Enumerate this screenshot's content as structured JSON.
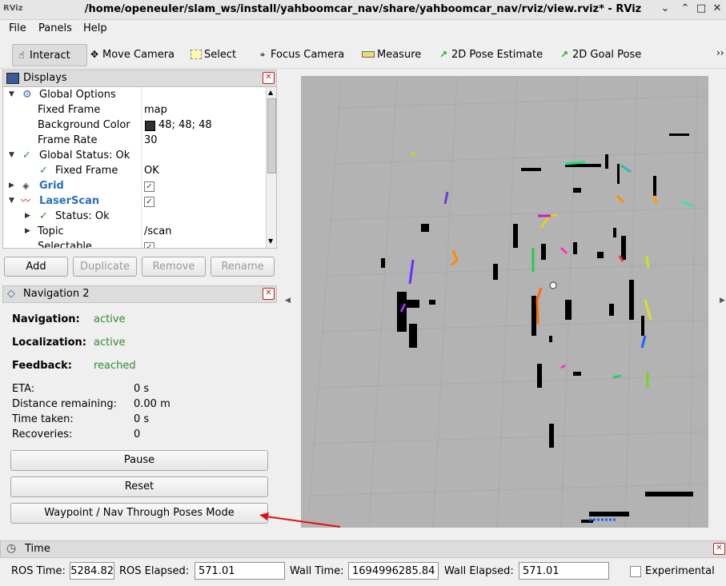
{
  "window": {
    "title": "/home/openeuler/slam_ws/install/yahboomcar_nav/share/yahboomcar_nav/rviz/view.rviz* - RViz",
    "app_icon": "RViz"
  },
  "menu": [
    "File",
    "Panels",
    "Help"
  ],
  "toolbar": {
    "tools": [
      "Interact",
      "Move Camera",
      "Select",
      "Focus Camera",
      "Measure",
      "2D Pose Estimate",
      "2D Goal Pose"
    ],
    "overflow": "››"
  },
  "displays": {
    "title": "Displays",
    "rows": [
      {
        "key": "Global Options",
        "value": ""
      },
      {
        "key": "Fixed Frame",
        "value": "map"
      },
      {
        "key": "Background Color",
        "value": "48; 48; 48"
      },
      {
        "key": "Frame Rate",
        "value": "30"
      },
      {
        "key": "Global Status: Ok",
        "value": ""
      },
      {
        "key": "Fixed Frame",
        "value": "OK"
      },
      {
        "key": "Grid",
        "value": ""
      },
      {
        "key": "LaserScan",
        "value": ""
      },
      {
        "key": "Status: Ok",
        "value": ""
      },
      {
        "key": "Topic",
        "value": "/scan"
      },
      {
        "key": "Selectable",
        "value": ""
      }
    ],
    "bg_color_hex": "#303030",
    "buttons": [
      "Add",
      "Duplicate",
      "Remove",
      "Rename"
    ]
  },
  "navigation": {
    "title": "Navigation 2",
    "status": [
      {
        "label": "Navigation:",
        "value": "active"
      },
      {
        "label": "Localization:",
        "value": "active"
      },
      {
        "label": "Feedback:",
        "value": "reached"
      }
    ],
    "metrics": [
      {
        "label": "ETA:",
        "value": "0 s"
      },
      {
        "label": "Distance remaining:",
        "value": "0.00 m"
      },
      {
        "label": "Time taken:",
        "value": "0 s"
      },
      {
        "label": "Recoveries:",
        "value": "0"
      }
    ],
    "buttons": [
      "Pause",
      "Reset",
      "Waypoint / Nav Through Poses Mode"
    ]
  },
  "time": {
    "title": "Time",
    "ros_time_label": "ROS Time:",
    "ros_time": "5284.82",
    "ros_elapsed_label": "ROS Elapsed:",
    "ros_elapsed": "571.01",
    "wall_time_label": "Wall Time:",
    "wall_time": "1694996285.84",
    "wall_elapsed_label": "Wall Elapsed:",
    "wall_elapsed": "571.01",
    "experimental_label": "Experimental"
  },
  "colors": {
    "annotation_arrow": "#e01010",
    "status_green": "#2e8b2e",
    "link_blue": "#2a6fbd"
  }
}
